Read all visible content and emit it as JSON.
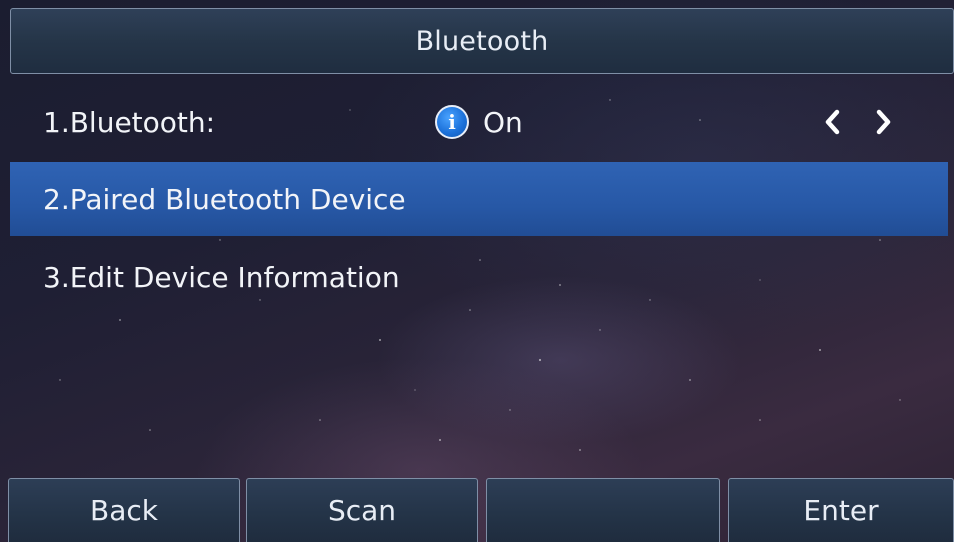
{
  "header": {
    "title": "Bluetooth"
  },
  "menu": {
    "items": [
      {
        "label": "1.Bluetooth:",
        "value": "On",
        "icon": "info-icon",
        "selected": false
      },
      {
        "label": "2.Paired Bluetooth Device",
        "selected": true
      },
      {
        "label": "3.Edit Device Information",
        "selected": false
      }
    ]
  },
  "softkeys": {
    "items": [
      {
        "label": "Back"
      },
      {
        "label": "Scan"
      },
      {
        "label": ""
      },
      {
        "label": "Enter"
      }
    ]
  },
  "colors": {
    "highlight": "#2a5cab",
    "title_bar": "#253548",
    "text": "#f2f4f8",
    "info_icon": "#1a6fd8"
  }
}
